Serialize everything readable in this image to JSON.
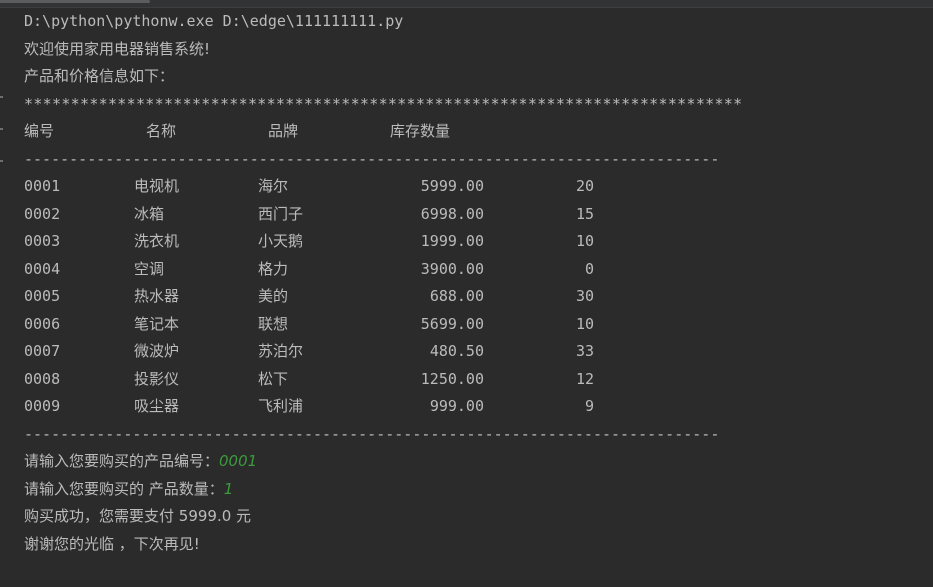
{
  "console": {
    "command": "D:\\python\\pythonw.exe D:\\edge\\111111111.py",
    "welcome": "欢迎使用家用电器销售系统!",
    "info_header": "产品和价格信息如下：",
    "star_rule": "*****************************************************************************",
    "dash_rule": "-----------------------------------------------------------------------------",
    "table": {
      "headers": [
        "编号",
        "名称",
        "品牌",
        "库存数量"
      ],
      "rows": [
        {
          "id": "0001",
          "name": "电视机",
          "brand": "海尔",
          "price": "5999.00",
          "qty": "20"
        },
        {
          "id": "0002",
          "name": "冰箱",
          "brand": "西门子",
          "price": "6998.00",
          "qty": "15"
        },
        {
          "id": "0003",
          "name": "洗衣机",
          "brand": "小天鹅",
          "price": "1999.00",
          "qty": "10"
        },
        {
          "id": "0004",
          "name": "空调",
          "brand": "格力",
          "price": "3900.00",
          "qty": "0"
        },
        {
          "id": "0005",
          "name": "热水器",
          "brand": "美的",
          "price": "688.00",
          "qty": "30"
        },
        {
          "id": "0006",
          "name": "笔记本",
          "brand": "联想",
          "price": "5699.00",
          "qty": "10"
        },
        {
          "id": "0007",
          "name": "微波炉",
          "brand": "苏泊尔",
          "price": "480.50",
          "qty": "33"
        },
        {
          "id": "0008",
          "name": "投影仪",
          "brand": "松下",
          "price": "1250.00",
          "qty": "12"
        },
        {
          "id": "0009",
          "name": "吸尘器",
          "brand": "飞利浦",
          "price": "999.00",
          "qty": "9"
        }
      ]
    },
    "prompt_id": "请输入您要购买的产品编号：",
    "input_id": "0001",
    "prompt_qty": "请输入您要购买的 产品数量：",
    "input_qty": "1",
    "purchase_result": "购买成功，您需要支付 5999.0 元",
    "goodbye": "谢谢您的光临 ，下次再见!"
  },
  "colors": {
    "background": "#2b2b2b",
    "text": "#bbbbbb",
    "user_input": "#3c9a3c"
  }
}
